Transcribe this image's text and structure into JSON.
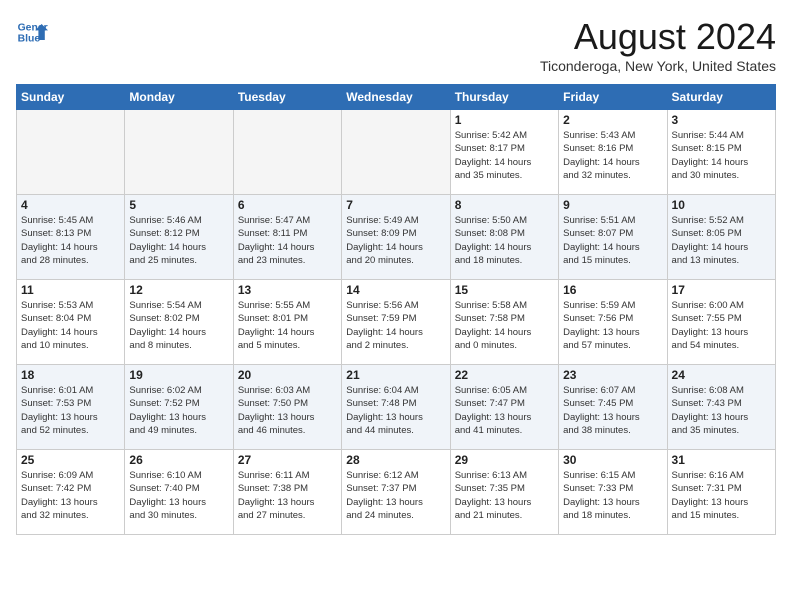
{
  "header": {
    "logo_line1": "General",
    "logo_line2": "Blue",
    "month": "August 2024",
    "location": "Ticonderoga, New York, United States"
  },
  "weekdays": [
    "Sunday",
    "Monday",
    "Tuesday",
    "Wednesday",
    "Thursday",
    "Friday",
    "Saturday"
  ],
  "weeks": [
    [
      {
        "day": "",
        "info": ""
      },
      {
        "day": "",
        "info": ""
      },
      {
        "day": "",
        "info": ""
      },
      {
        "day": "",
        "info": ""
      },
      {
        "day": "1",
        "info": "Sunrise: 5:42 AM\nSunset: 8:17 PM\nDaylight: 14 hours\nand 35 minutes."
      },
      {
        "day": "2",
        "info": "Sunrise: 5:43 AM\nSunset: 8:16 PM\nDaylight: 14 hours\nand 32 minutes."
      },
      {
        "day": "3",
        "info": "Sunrise: 5:44 AM\nSunset: 8:15 PM\nDaylight: 14 hours\nand 30 minutes."
      }
    ],
    [
      {
        "day": "4",
        "info": "Sunrise: 5:45 AM\nSunset: 8:13 PM\nDaylight: 14 hours\nand 28 minutes."
      },
      {
        "day": "5",
        "info": "Sunrise: 5:46 AM\nSunset: 8:12 PM\nDaylight: 14 hours\nand 25 minutes."
      },
      {
        "day": "6",
        "info": "Sunrise: 5:47 AM\nSunset: 8:11 PM\nDaylight: 14 hours\nand 23 minutes."
      },
      {
        "day": "7",
        "info": "Sunrise: 5:49 AM\nSunset: 8:09 PM\nDaylight: 14 hours\nand 20 minutes."
      },
      {
        "day": "8",
        "info": "Sunrise: 5:50 AM\nSunset: 8:08 PM\nDaylight: 14 hours\nand 18 minutes."
      },
      {
        "day": "9",
        "info": "Sunrise: 5:51 AM\nSunset: 8:07 PM\nDaylight: 14 hours\nand 15 minutes."
      },
      {
        "day": "10",
        "info": "Sunrise: 5:52 AM\nSunset: 8:05 PM\nDaylight: 14 hours\nand 13 minutes."
      }
    ],
    [
      {
        "day": "11",
        "info": "Sunrise: 5:53 AM\nSunset: 8:04 PM\nDaylight: 14 hours\nand 10 minutes."
      },
      {
        "day": "12",
        "info": "Sunrise: 5:54 AM\nSunset: 8:02 PM\nDaylight: 14 hours\nand 8 minutes."
      },
      {
        "day": "13",
        "info": "Sunrise: 5:55 AM\nSunset: 8:01 PM\nDaylight: 14 hours\nand 5 minutes."
      },
      {
        "day": "14",
        "info": "Sunrise: 5:56 AM\nSunset: 7:59 PM\nDaylight: 14 hours\nand 2 minutes."
      },
      {
        "day": "15",
        "info": "Sunrise: 5:58 AM\nSunset: 7:58 PM\nDaylight: 14 hours\nand 0 minutes."
      },
      {
        "day": "16",
        "info": "Sunrise: 5:59 AM\nSunset: 7:56 PM\nDaylight: 13 hours\nand 57 minutes."
      },
      {
        "day": "17",
        "info": "Sunrise: 6:00 AM\nSunset: 7:55 PM\nDaylight: 13 hours\nand 54 minutes."
      }
    ],
    [
      {
        "day": "18",
        "info": "Sunrise: 6:01 AM\nSunset: 7:53 PM\nDaylight: 13 hours\nand 52 minutes."
      },
      {
        "day": "19",
        "info": "Sunrise: 6:02 AM\nSunset: 7:52 PM\nDaylight: 13 hours\nand 49 minutes."
      },
      {
        "day": "20",
        "info": "Sunrise: 6:03 AM\nSunset: 7:50 PM\nDaylight: 13 hours\nand 46 minutes."
      },
      {
        "day": "21",
        "info": "Sunrise: 6:04 AM\nSunset: 7:48 PM\nDaylight: 13 hours\nand 44 minutes."
      },
      {
        "day": "22",
        "info": "Sunrise: 6:05 AM\nSunset: 7:47 PM\nDaylight: 13 hours\nand 41 minutes."
      },
      {
        "day": "23",
        "info": "Sunrise: 6:07 AM\nSunset: 7:45 PM\nDaylight: 13 hours\nand 38 minutes."
      },
      {
        "day": "24",
        "info": "Sunrise: 6:08 AM\nSunset: 7:43 PM\nDaylight: 13 hours\nand 35 minutes."
      }
    ],
    [
      {
        "day": "25",
        "info": "Sunrise: 6:09 AM\nSunset: 7:42 PM\nDaylight: 13 hours\nand 32 minutes."
      },
      {
        "day": "26",
        "info": "Sunrise: 6:10 AM\nSunset: 7:40 PM\nDaylight: 13 hours\nand 30 minutes."
      },
      {
        "day": "27",
        "info": "Sunrise: 6:11 AM\nSunset: 7:38 PM\nDaylight: 13 hours\nand 27 minutes."
      },
      {
        "day": "28",
        "info": "Sunrise: 6:12 AM\nSunset: 7:37 PM\nDaylight: 13 hours\nand 24 minutes."
      },
      {
        "day": "29",
        "info": "Sunrise: 6:13 AM\nSunset: 7:35 PM\nDaylight: 13 hours\nand 21 minutes."
      },
      {
        "day": "30",
        "info": "Sunrise: 6:15 AM\nSunset: 7:33 PM\nDaylight: 13 hours\nand 18 minutes."
      },
      {
        "day": "31",
        "info": "Sunrise: 6:16 AM\nSunset: 7:31 PM\nDaylight: 13 hours\nand 15 minutes."
      }
    ]
  ]
}
